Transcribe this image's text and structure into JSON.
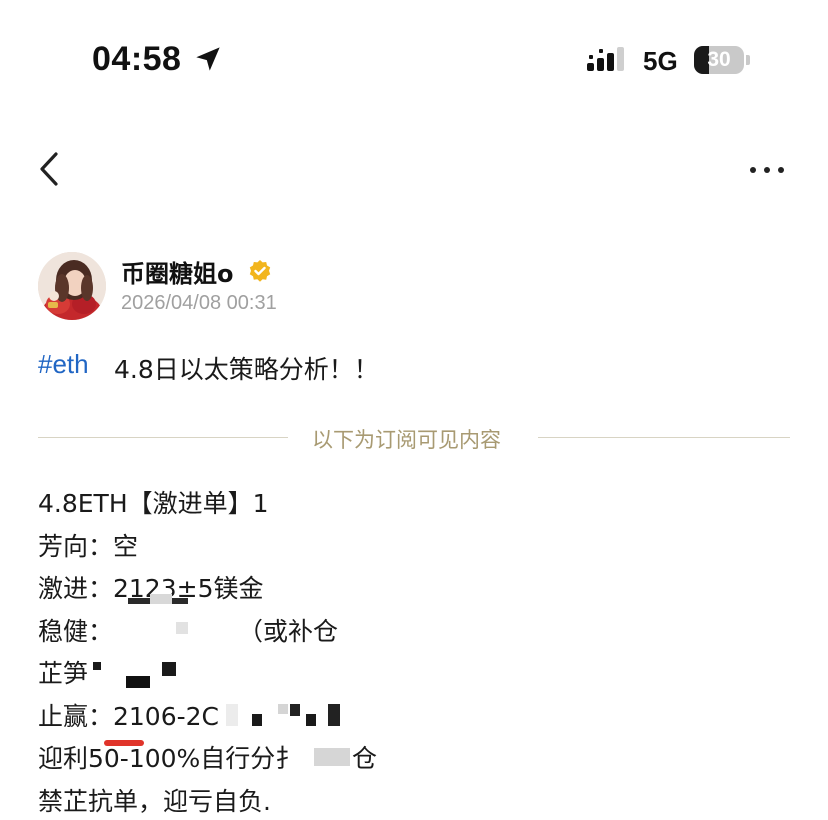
{
  "status_bar": {
    "time": "04:58",
    "network": "5G",
    "battery": 30,
    "battery_text": "30",
    "icons": [
      "location-arrow-icon",
      "signal-icon"
    ]
  },
  "nav": {
    "back_icon": "chevron-left-icon",
    "more_icon": "more-icon"
  },
  "author": {
    "name": "币圈糖姐o",
    "verified_icon": "verified-badge-icon",
    "post_time": "2026/04/08 00:31"
  },
  "post": {
    "hashtag": "#eth",
    "title": "4.8日以太策略分析！！",
    "divider_text": "以下为订阅可见内容",
    "lines": [
      "4.8ETH【激进单】1",
      "芳向：空",
      "激进：2123±5镁金",
      "稳健：",
      "（或补仓",
      "芷笋",
      "止赢：2106-2C",
      "迎利50-100%自行分扌",
      "仓",
      "禁芷抗单，迎亏自负."
    ]
  },
  "colors": {
    "link": "#2166c4",
    "divider_text": "#a89a72",
    "divider_line": "#d8d4c4",
    "time_gray": "#a0a0a0",
    "verified": "#f2b51d",
    "underline": "#e0342a"
  }
}
